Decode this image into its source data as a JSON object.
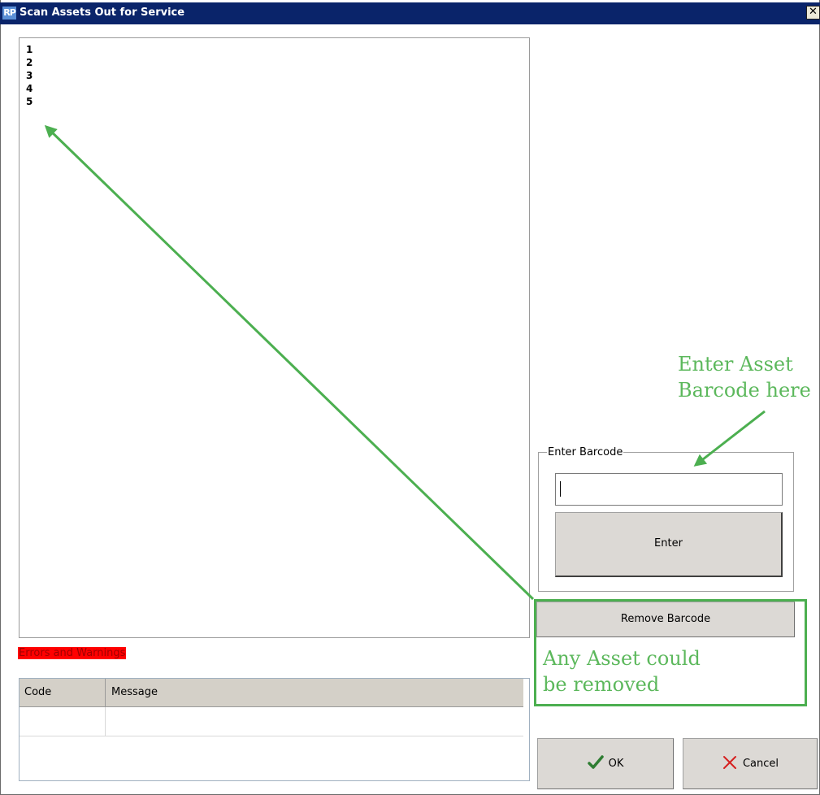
{
  "window": {
    "icon_text": "RP",
    "title": "Scan Assets Out for Service",
    "close_glyph": "✕"
  },
  "asset_list": {
    "lines": [
      "1",
      "2",
      "3",
      "4",
      "5"
    ]
  },
  "errors": {
    "label": "Errors and Warnings",
    "columns": [
      "Code",
      "Message"
    ],
    "rows": [
      [
        "",
        ""
      ]
    ]
  },
  "barcode": {
    "group_label": "Enter Barcode",
    "input_value": "",
    "enter_label": "Enter",
    "remove_label": "Remove Barcode"
  },
  "actions": {
    "ok_label": "OK",
    "cancel_label": "Cancel"
  },
  "annotations": {
    "enter_line1": "Enter Asset",
    "enter_line2": "Barcode here",
    "remove_line1": "Any Asset could",
    "remove_line2": "be removed"
  },
  "colors": {
    "title_bar": "#0a246a",
    "annotation_green": "#5cb85c",
    "error_label_bg": "#ff0000",
    "ok_check": "#2e7d32",
    "cancel_x": "#d62020"
  }
}
